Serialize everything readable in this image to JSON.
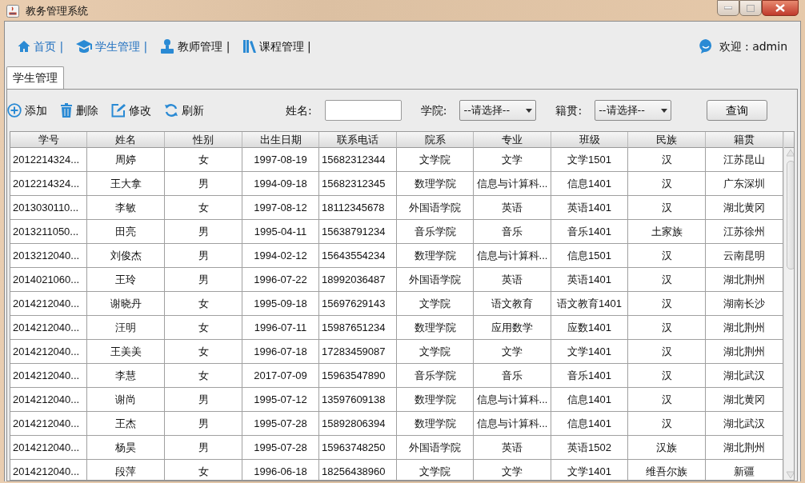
{
  "window": {
    "title": "教务管理系统"
  },
  "nav": [
    {
      "label": "首页 |",
      "highlighted": true
    },
    {
      "label": "学生管理 |",
      "highlighted": true
    },
    {
      "label": "教师管理 |",
      "highlighted": false
    },
    {
      "label": "课程管理 |",
      "highlighted": false
    }
  ],
  "welcome": "欢迎 : admin",
  "tabs": [
    {
      "label": "学生管理",
      "selected": true
    }
  ],
  "toolbar": [
    {
      "label": "添加"
    },
    {
      "label": "删除"
    },
    {
      "label": "修改"
    },
    {
      "label": "刷新"
    }
  ],
  "filters": [
    {
      "label": "姓名:",
      "kind": "text"
    },
    {
      "label": "学院:",
      "kind": "select",
      "value": "--请选择--"
    },
    {
      "label": "籍贯:",
      "kind": "select",
      "value": "--请选择--"
    }
  ],
  "query_button": "查询",
  "table": {
    "columns": [
      "学号",
      "姓名",
      "性别",
      "出生日期",
      "联系电话",
      "院系",
      "专业",
      "班级",
      "民族",
      "籍贯"
    ],
    "rows": [
      [
        "2012214324...",
        "周婷",
        "女",
        "1997-08-19",
        "15682312344",
        "文学院",
        "文学",
        "文学1501",
        "汉",
        "江苏昆山"
      ],
      [
        "2012214324...",
        "王大拿",
        "男",
        "1994-09-18",
        "15682312345",
        "数理学院",
        "信息与计算科...",
        "信息1401",
        "汉",
        "广东深圳"
      ],
      [
        "2013030110...",
        "李敏",
        "女",
        "1997-08-12",
        "18112345678",
        "外国语学院",
        "英语",
        "英语1401",
        "汉",
        "湖北黄冈"
      ],
      [
        "2013211050...",
        "田亮",
        "男",
        "1995-04-11",
        "15638791234",
        "音乐学院",
        "音乐",
        "音乐1401",
        "土家族",
        "江苏徐州"
      ],
      [
        "2013212040...",
        "刘俊杰",
        "男",
        "1994-02-12",
        "15643554234",
        "数理学院",
        "信息与计算科...",
        "信息1501",
        "汉",
        "云南昆明"
      ],
      [
        "2014021060...",
        "王玲",
        "男",
        "1996-07-22",
        "18992036487",
        "外国语学院",
        "英语",
        "英语1401",
        "汉",
        "湖北荆州"
      ],
      [
        "2014212040...",
        "谢晓丹",
        "女",
        "1995-09-18",
        "15697629143",
        "文学院",
        "语文教育",
        "语文教育1401",
        "汉",
        "湖南长沙"
      ],
      [
        "2014212040...",
        "汪明",
        "女",
        "1996-07-11",
        "15987651234",
        "数理学院",
        "应用数学",
        "应数1401",
        "汉",
        "湖北荆州"
      ],
      [
        "2014212040...",
        "王美美",
        "女",
        "1996-07-18",
        "17283459087",
        "文学院",
        "文学",
        "文学1401",
        "汉",
        "湖北荆州"
      ],
      [
        "2014212040...",
        "李慧",
        "女",
        "2017-07-09",
        "15963547890",
        "音乐学院",
        "音乐",
        "音乐1401",
        "汉",
        "湖北武汉"
      ],
      [
        "2014212040...",
        "谢尚",
        "男",
        "1995-07-12",
        "13597609138",
        "数理学院",
        "信息与计算科...",
        "信息1401",
        "汉",
        "湖北黄冈"
      ],
      [
        "2014212040...",
        "王杰",
        "男",
        "1995-07-28",
        "15892806394",
        "数理学院",
        "信息与计算科...",
        "信息1401",
        "汉",
        "湖北武汉"
      ],
      [
        "2014212040...",
        "杨昊",
        "男",
        "1995-07-28",
        "15963748250",
        "外国语学院",
        "英语",
        "英语1502",
        "汉族",
        "湖北荆州"
      ],
      [
        "2014212040...",
        "段萍",
        "女",
        "1996-06-18",
        "18256438960",
        "文学院",
        "文学",
        "文学1401",
        "维吾尔族",
        "新疆"
      ]
    ]
  }
}
